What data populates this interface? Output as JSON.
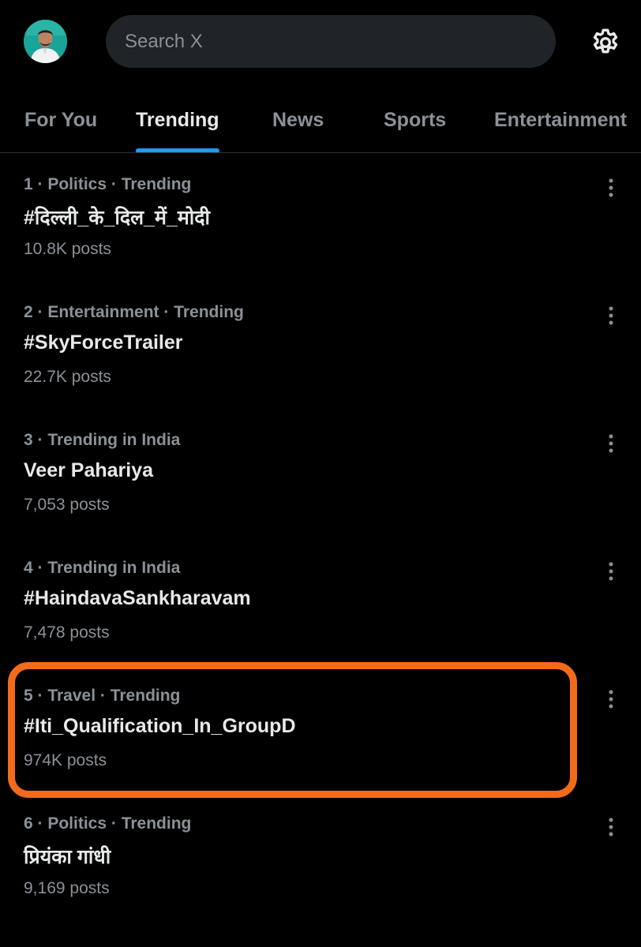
{
  "header": {
    "search_placeholder": "Search X",
    "avatar": "profile-avatar",
    "settings_icon": "gear-icon"
  },
  "tabs": [
    {
      "label": "For You",
      "active": false
    },
    {
      "label": "Trending",
      "active": true
    },
    {
      "label": "News",
      "active": false
    },
    {
      "label": "Sports",
      "active": false
    },
    {
      "label": "Entertainment",
      "active": false
    }
  ],
  "trends": [
    {
      "meta": "1 · Politics · Trending",
      "topic": "#दिल्ली_के_दिल_में_मोदी",
      "count": "10.8K posts"
    },
    {
      "meta": "2 · Entertainment · Trending",
      "topic": "#SkyForceTrailer",
      "count": "22.7K posts"
    },
    {
      "meta": "3 · Trending in India",
      "topic": "Veer Pahariya",
      "count": "7,053 posts"
    },
    {
      "meta": "4 · Trending in India",
      "topic": "#HaindavaSankharavam",
      "count": "7,478 posts"
    },
    {
      "meta": "5 · Travel · Trending",
      "topic": "#Iti_Qualification_In_GroupD",
      "count": "974K posts"
    },
    {
      "meta": "6 · Politics · Trending",
      "topic": "प्रियंका गांधी",
      "count": "9,169 posts"
    }
  ],
  "colors": {
    "background": "#000000",
    "accent": "#1d9bf0",
    "highlight": "#f26b1d",
    "secondary_text": "#8b9197"
  }
}
